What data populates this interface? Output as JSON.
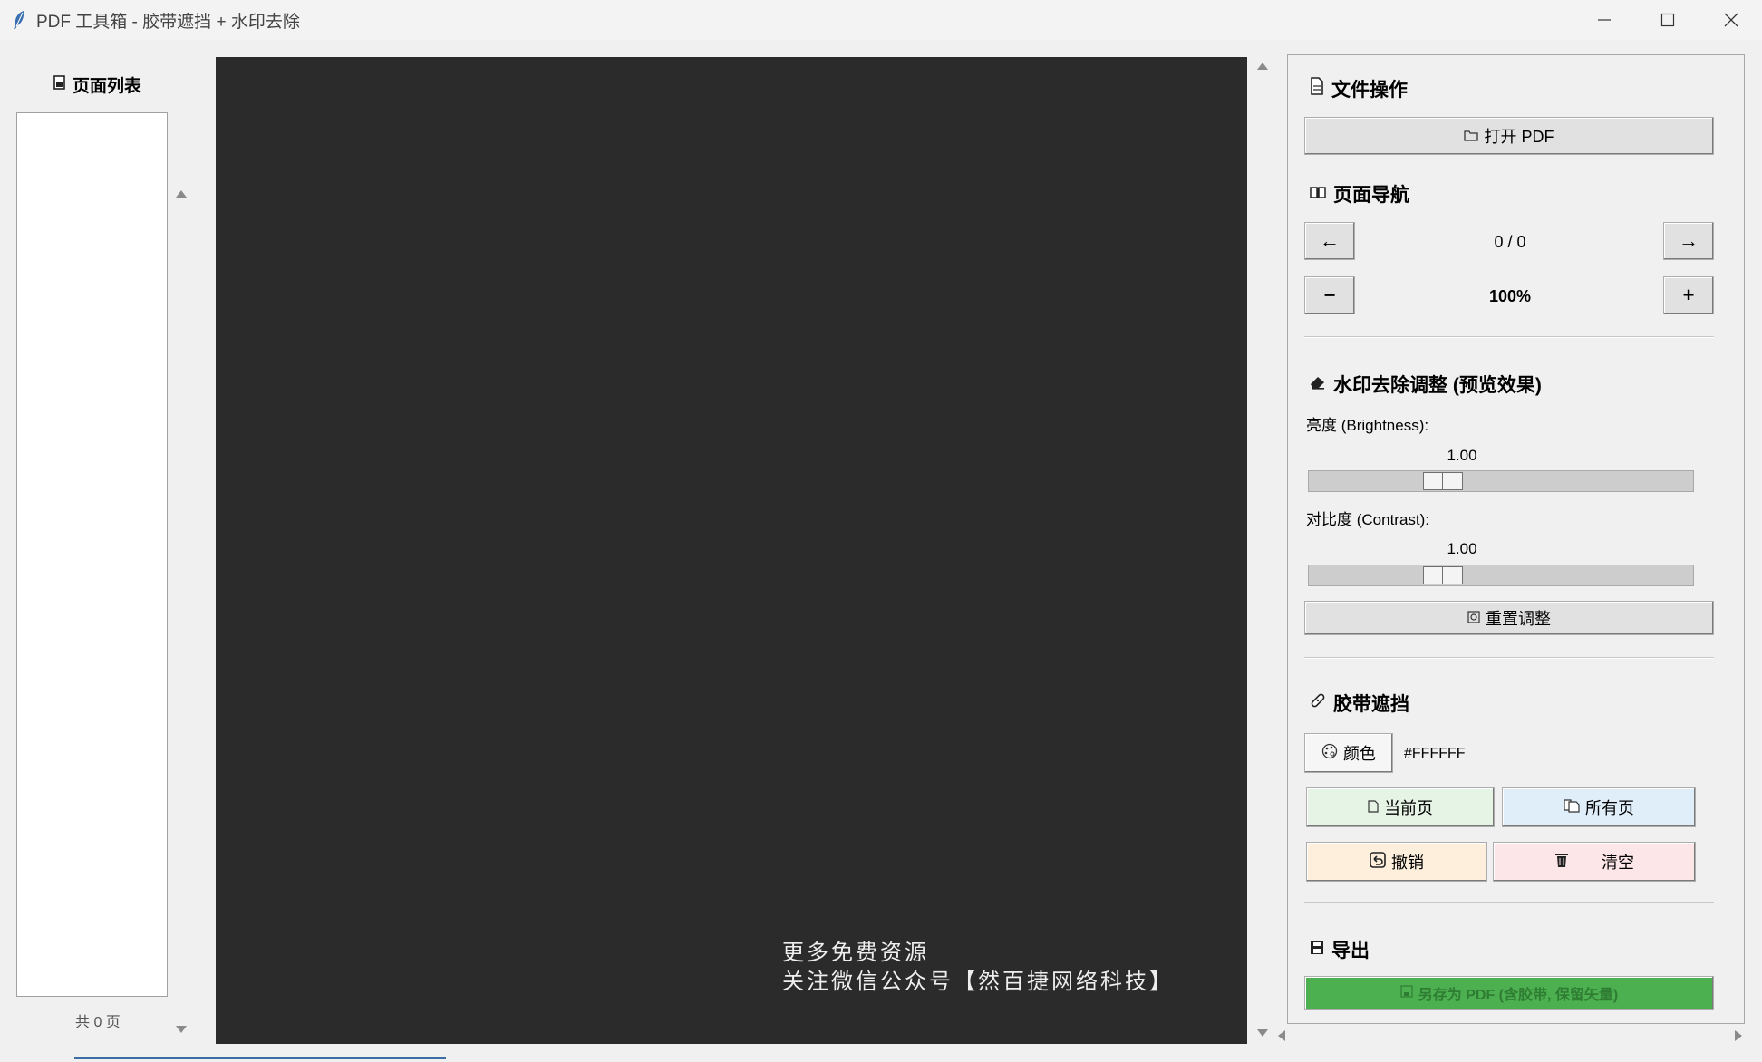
{
  "window": {
    "title": "PDF 工具箱 - 胶带遮挡 + 水印去除",
    "icon": "feather-icon"
  },
  "left_panel": {
    "header": "页面列表",
    "header_icon": "page-list-icon",
    "page_count": "共 0 页"
  },
  "canvas": {
    "background": "#2b2b2b",
    "watermark_line1": "更多免费资源",
    "watermark_line2": "关注微信公众号【然百捷网络科技】"
  },
  "file_ops": {
    "title": "文件操作",
    "open_label": "打开 PDF"
  },
  "navigation": {
    "title": "页面导航",
    "prev_symbol": "←",
    "next_symbol": "→",
    "page_indicator": "0 / 0",
    "zoom_out_symbol": "−",
    "zoom_in_symbol": "+",
    "zoom_level": "100%"
  },
  "watermark": {
    "title": "水印去除调整 (预览效果)",
    "brightness_label": "亮度 (Brightness):",
    "brightness_value": "1.00",
    "brightness_fraction": 0.33,
    "contrast_label": "对比度 (Contrast):",
    "contrast_value": "1.00",
    "contrast_fraction": 0.33,
    "reset_label": "重置调整"
  },
  "tape": {
    "title": "胶带遮挡",
    "color_button_label": "颜色",
    "color_value": "#FFFFFF",
    "current_page_label": "当前页",
    "all_pages_label": "所有页",
    "undo_label": "撤销",
    "clear_label": "清空",
    "colors": {
      "current_page_bg": "#e6f4e6",
      "all_pages_bg": "#e0eefa",
      "undo_bg": "#fdefdc",
      "clear_bg": "#fde6e8"
    }
  },
  "export": {
    "title": "导出",
    "save_label": "另存为 PDF (含胶带, 保留矢量)",
    "save_bg": "#4caf50"
  }
}
